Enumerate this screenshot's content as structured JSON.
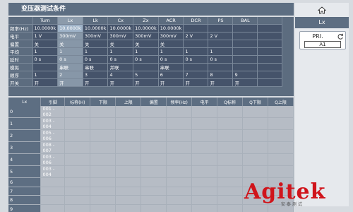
{
  "title": "变压器测试条件",
  "side": {
    "header": "Lx",
    "mode_label": "PRI.",
    "mode_value": "A1"
  },
  "params": {
    "columns": [
      "",
      "Turn",
      "Lx",
      "Lk",
      "Cx",
      "Zx",
      "ACR",
      "DCR",
      "PS",
      "BAL",
      ""
    ],
    "rows": [
      {
        "label": "频率(Hz)",
        "cells": [
          "10.0000k",
          "10.0000k",
          "10.0000k",
          "10.0000k",
          "10.0000k",
          "10.0000k",
          "",
          "",
          "",
          ""
        ]
      },
      {
        "label": "电平",
        "cells": [
          "1 V",
          "300mV",
          "300mV",
          "300mV",
          "300mV",
          "300mV",
          "2 V",
          "2 V",
          "",
          ""
        ]
      },
      {
        "label": "偏置",
        "cells": [
          "关",
          "关",
          "关",
          "关",
          "关",
          "关",
          "",
          "",
          "",
          ""
        ]
      },
      {
        "label": "平均",
        "cells": [
          "1",
          "1",
          "1",
          "1",
          "1",
          "1",
          "1",
          "1",
          "",
          ""
        ]
      },
      {
        "label": "延时",
        "cells": [
          "0 s",
          "0 s",
          "0 s",
          "0 s",
          "0 s",
          "0 s",
          "0 s",
          "0 s",
          "",
          ""
        ]
      },
      {
        "label": "模拟",
        "cells": [
          "",
          "串联",
          "串联",
          "并联",
          "",
          "串联",
          "",
          "",
          "",
          ""
        ]
      },
      {
        "label": "顺序",
        "cells": [
          "1",
          "2",
          "3",
          "4",
          "5",
          "6",
          "7",
          "8",
          "9",
          ""
        ]
      },
      {
        "label": "开关",
        "cells": [
          "开",
          "开",
          "开",
          "开",
          "开",
          "开",
          "开",
          "开",
          "开",
          ""
        ]
      }
    ]
  },
  "list": {
    "headers": [
      "Lx",
      "引脚",
      "标称(H)",
      "下限",
      "上限",
      "偏置",
      "频率(Hz)",
      "电平",
      "Q标称",
      "Q下限",
      "Q上限"
    ],
    "rows": [
      {
        "idx": "0",
        "pin": "001 - 002"
      },
      {
        "idx": "1",
        "pin": "003 - 004"
      },
      {
        "idx": "2",
        "pin": "005 - 006"
      },
      {
        "idx": "3",
        "pin": "008 - 007"
      },
      {
        "idx": "4",
        "pin": "003 - 006"
      },
      {
        "idx": "5",
        "pin": "003 - 004"
      },
      {
        "idx": "6",
        "pin": ""
      },
      {
        "idx": "7",
        "pin": ""
      },
      {
        "idx": "8",
        "pin": ""
      },
      {
        "idx": "9",
        "pin": ""
      }
    ]
  },
  "logo": {
    "text": "Agitek",
    "sub": "安 泰 测 试"
  },
  "icons": {
    "home": "home-icon",
    "refresh": "refresh-icon"
  }
}
